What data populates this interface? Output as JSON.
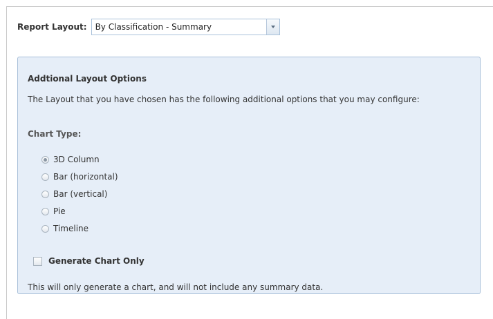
{
  "report_layout": {
    "label": "Report Layout:",
    "selected": "By Classification - Summary"
  },
  "options_panel": {
    "title": "Addtional Layout Options",
    "description": "The Layout that you have chosen has the following additional options that you may configure:",
    "chart_type": {
      "label": "Chart Type:",
      "options": [
        {
          "label": "3D Column",
          "checked": true
        },
        {
          "label": "Bar (horizontal)",
          "checked": false
        },
        {
          "label": "Bar (vertical)",
          "checked": false
        },
        {
          "label": "Pie",
          "checked": false
        },
        {
          "label": "Timeline",
          "checked": false
        }
      ]
    },
    "generate_chart_only": {
      "label": "Generate Chart Only",
      "checked": false
    },
    "note": "This will only generate a chart, and will not include any summary data."
  }
}
